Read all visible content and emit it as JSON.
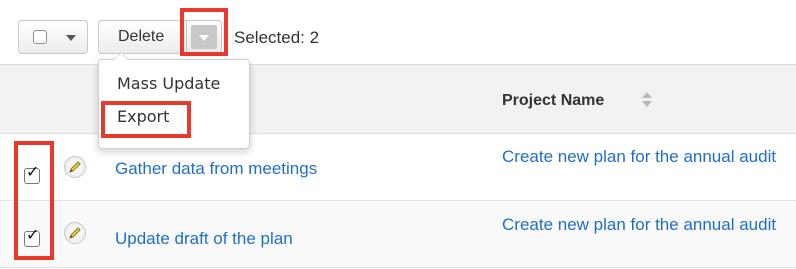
{
  "caption": "clipped heading text above toolbar",
  "toolbar": {
    "delete_label": "Delete",
    "selected_text": "Selected: 2"
  },
  "dropdown": {
    "items": [
      "Mass Update",
      "Export"
    ]
  },
  "table": {
    "column_header": "Project Name",
    "rows": [
      {
        "subject": "Gather data from meetings",
        "project": "Create new plan for the annual audit",
        "checked": true
      },
      {
        "subject": "Update draft of the plan",
        "project": "Create new plan for the annual audit",
        "checked": true
      }
    ]
  },
  "colors": {
    "highlight": "#e8392b",
    "link": "#1f6fc6",
    "header_bg": "#f2f2f2"
  },
  "icons": [
    "chevron-down-icon",
    "pencil-icon",
    "sort-icon",
    "checkmark-icon"
  ]
}
